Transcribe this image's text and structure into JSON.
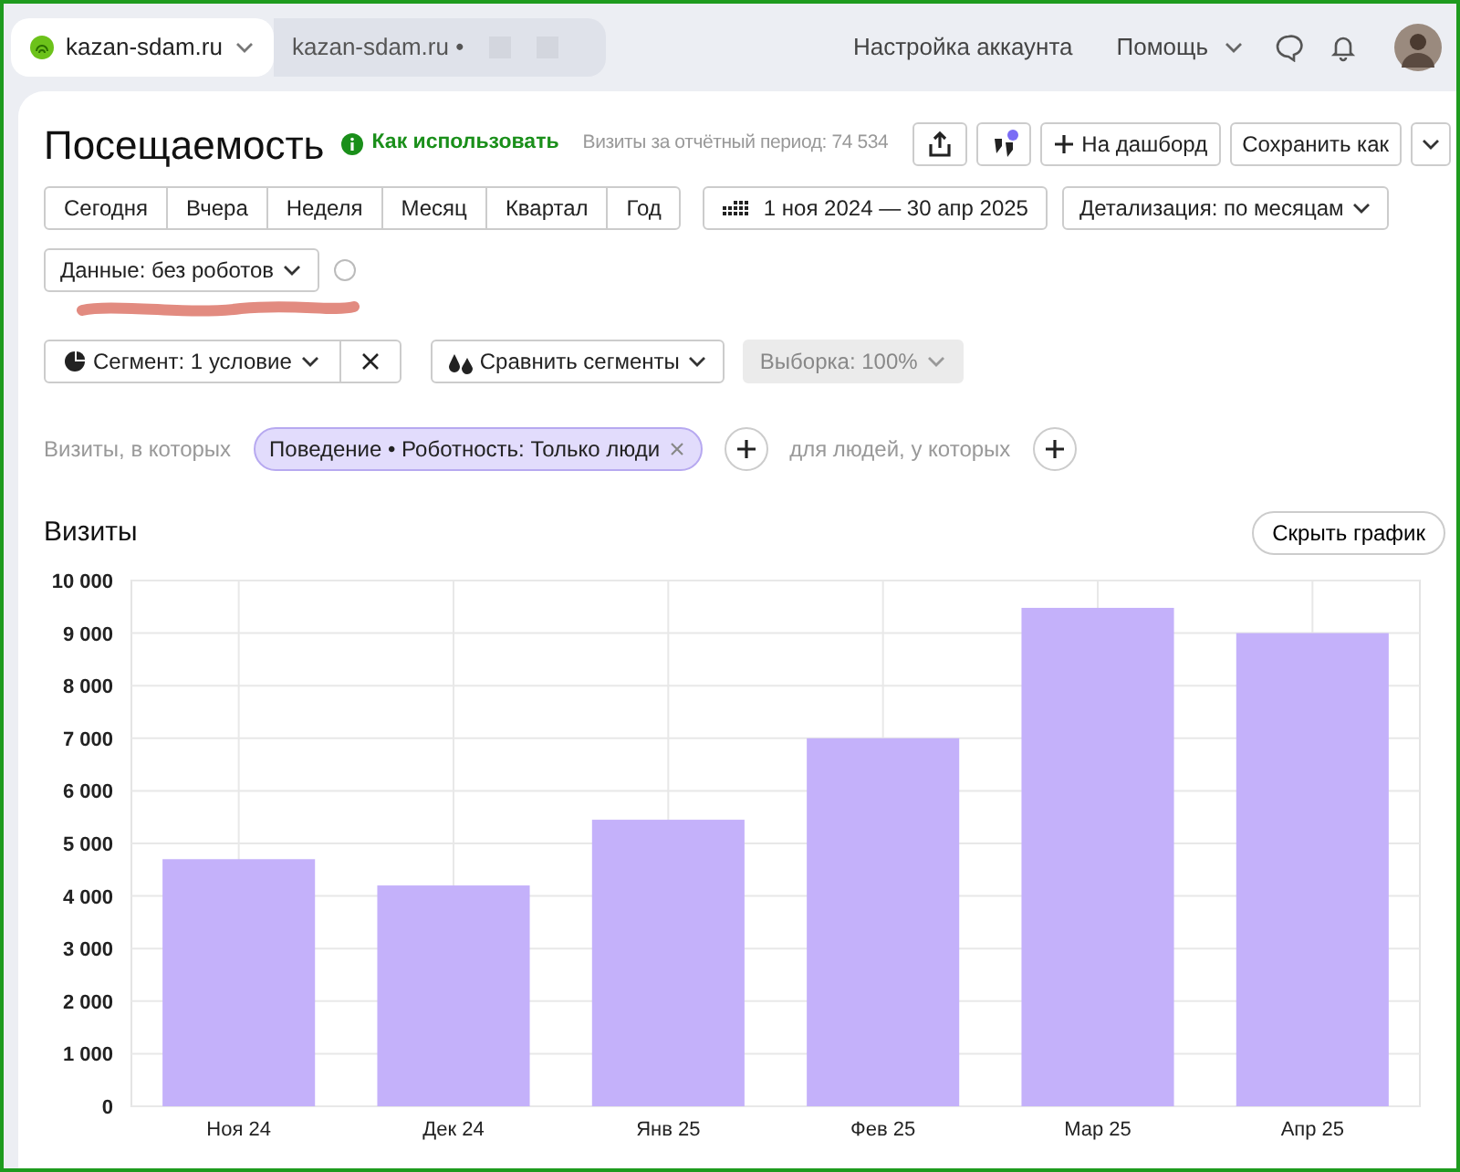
{
  "top_bar": {
    "counters": [
      {
        "label": "kazan-sdam.ru",
        "selected": true
      },
      {
        "label": "kazan-sdam.ru •",
        "selected": false
      }
    ],
    "account_link": "Настройка аккаунта",
    "help_menu": "Помощь"
  },
  "header": {
    "title": "Посещаемость",
    "help_link": "Как использовать",
    "summary": "Визиты за отчётный период: 74 534",
    "dashboard_button": "На дашборд",
    "save_button": "Сохранить как"
  },
  "periods": [
    "Сегодня",
    "Вчера",
    "Неделя",
    "Месяц",
    "Квартал",
    "Год"
  ],
  "date_range": "1 ноя 2024 — 30 апр 2025",
  "detail": "Детализация: по месяцам",
  "data_filter": "Данные: без роботов",
  "segment": "Сегмент: 1 условие",
  "compare": "Сравнить сегменты",
  "sample": {
    "label": "Выборка: 100%",
    "disabled": true
  },
  "filter": {
    "prefix": "Визиты, в которых",
    "tag": "Поведение • Роботность: Только люди",
    "middle": "для людей, у которых"
  },
  "chart_section": {
    "hide_button": "Скрыть график",
    "chart_data": {
      "type": "bar",
      "grid": true,
      "categories": [
        "Ноя 24",
        "Дек 24",
        "Янв 25",
        "Фев 25",
        "Мар 25",
        "Апр 25"
      ],
      "series": [
        {
          "name": "Визиты",
          "color": "#c4b1fa",
          "values": [
            4700,
            4200,
            5450,
            7000,
            9480,
            9000
          ]
        }
      ],
      "ylim": [
        0,
        10000
      ],
      "yticks": [
        {
          "value": 0,
          "label": "0"
        },
        {
          "value": 1000,
          "label": "1 000"
        },
        {
          "value": 2000,
          "label": "2 000"
        },
        {
          "value": 3000,
          "label": "3 000"
        },
        {
          "value": 4000,
          "label": "4 000"
        },
        {
          "value": 5000,
          "label": "5 000"
        },
        {
          "value": 6000,
          "label": "6 000"
        },
        {
          "value": 7000,
          "label": "7 000"
        },
        {
          "value": 8000,
          "label": "8 000"
        },
        {
          "value": 9000,
          "label": "9 000"
        },
        {
          "value": 10000,
          "label": "10 000"
        }
      ]
    }
  }
}
